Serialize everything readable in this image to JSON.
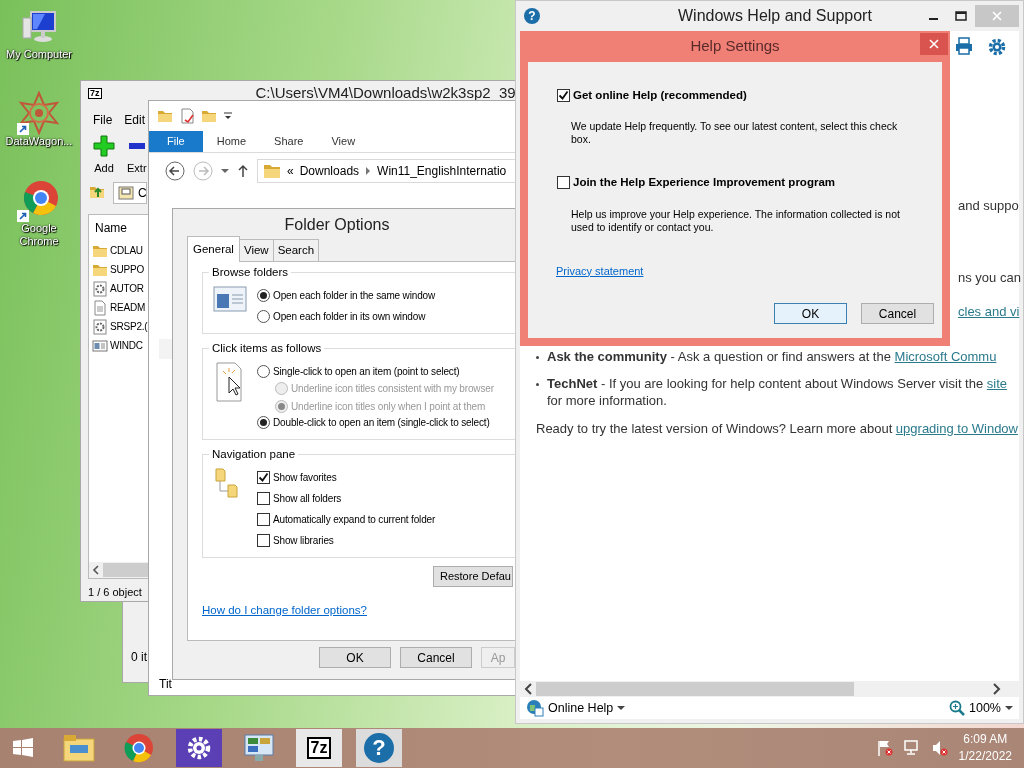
{
  "desktop_icons": [
    {
      "label": "My Computer",
      "kind": "computer"
    },
    {
      "label": "DataWagon...",
      "kind": "mandala"
    },
    {
      "label": "Google Chrome",
      "kind": "browser"
    }
  ],
  "zip_window": {
    "logo": "7z",
    "title": "C:\\Users\\VM4\\Downloads\\w2k3sp2_39",
    "menu": [
      "File",
      "Edit"
    ],
    "toolbar": [
      {
        "label": "Add",
        "kind": "add"
      },
      {
        "label": "Extr",
        "kind": "extract"
      }
    ],
    "address": "C",
    "column": "Name",
    "files": [
      {
        "name": "CDLAU",
        "kind": "folder"
      },
      {
        "name": "SUPPO",
        "kind": "folder"
      },
      {
        "name": "AUTOR",
        "kind": "setup"
      },
      {
        "name": "READM",
        "kind": "text"
      },
      {
        "name": "SRSP2.(",
        "kind": "setup"
      },
      {
        "name": "WINDC",
        "kind": "app"
      }
    ],
    "status": "1 / 6 object"
  },
  "back_window": {
    "status": "0 it"
  },
  "explorer": {
    "ribbon_tabs": [
      {
        "label": "File",
        "selected": true
      },
      {
        "label": "Home",
        "selected": false
      },
      {
        "label": "Share",
        "selected": false
      },
      {
        "label": "View",
        "selected": false
      }
    ],
    "breadcrumb_prefix": "«",
    "breadcrumb": [
      "Downloads",
      "Win11_EnglishInternatio"
    ],
    "column": "Tit"
  },
  "folder_options": {
    "title": "Folder Options",
    "tabs": [
      {
        "label": "General",
        "selected": true
      },
      {
        "label": "View",
        "selected": false
      },
      {
        "label": "Search",
        "selected": false
      }
    ],
    "groups": [
      {
        "title": "Browse folders",
        "kind": "radio",
        "options": [
          {
            "label": "Open each folder in the same window",
            "selected": true,
            "disabled": false
          },
          {
            "label": "Open each folder in its own window",
            "selected": false,
            "disabled": false
          }
        ]
      },
      {
        "title": "Click items as follows",
        "kind": "radio",
        "options": [
          {
            "label": "Single-click to open an item (point to select)",
            "selected": false,
            "disabled": false,
            "children": [
              {
                "label": "Underline icon titles consistent with my browser",
                "selected": false,
                "disabled": true
              },
              {
                "label": "Underline icon titles only when I point at them",
                "selected": true,
                "disabled": true
              }
            ]
          },
          {
            "label": "Double-click to open an item (single-click to select)",
            "selected": true,
            "disabled": false
          }
        ]
      },
      {
        "title": "Navigation pane",
        "kind": "checkbox",
        "options": [
          {
            "label": "Show favorites",
            "checked": true
          },
          {
            "label": "Show all folders",
            "checked": false
          },
          {
            "label": "Automatically expand to current folder",
            "checked": false
          },
          {
            "label": "Show libraries",
            "checked": false
          }
        ]
      }
    ],
    "restore_button": "Restore Defau",
    "link": "How do I change folder options?",
    "buttons": [
      {
        "label": "OK",
        "disabled": false
      },
      {
        "label": "Cancel",
        "disabled": false
      },
      {
        "label": "Ap",
        "disabled": true
      }
    ]
  },
  "help_window": {
    "icon": "?",
    "title": "Windows Help and Support",
    "fragments": [
      {
        "text": "and suppo",
        "kind": "text"
      },
      {
        "text": "ns you can",
        "kind": "text"
      },
      {
        "text": "cles and vi",
        "kind": "link"
      }
    ],
    "bullets": [
      {
        "title": "Ask the community",
        "text": " - Ask a question or find answers at the ",
        "link": "Microsoft Commu"
      },
      {
        "title": "TechNet",
        "text": " - If you are looking for help content about Windows Server visit the ",
        "link": "site",
        "after": " for more information."
      }
    ],
    "closing": {
      "text": "Ready to try the latest version of Windows? Learn more about ",
      "link": "upgrading to Window"
    },
    "footer": {
      "source": "Online Help",
      "zoom": "100%"
    }
  },
  "help_settings": {
    "title": "Help Settings",
    "options": [
      {
        "label": "Get online Help (recommended)",
        "checked": true,
        "description": "We update Help frequently. To see our latest content, select this check box."
      },
      {
        "label": "Join the Help Experience Improvement program",
        "checked": false,
        "description": "Help us improve your Help experience. The information collected is not used to identify or contact you."
      }
    ],
    "link": "Privacy statement",
    "buttons": [
      {
        "label": "OK",
        "default": true
      },
      {
        "label": "Cancel",
        "default": false
      }
    ]
  },
  "taskbar": {
    "apps": [
      {
        "kind": "explorer"
      },
      {
        "kind": "browser"
      },
      {
        "kind": "gear"
      },
      {
        "kind": "control"
      },
      {
        "kind": "zip",
        "label": "7z"
      },
      {
        "kind": "help",
        "label": "?"
      }
    ],
    "time": "6:09 AM",
    "date": "1/22/2022"
  }
}
